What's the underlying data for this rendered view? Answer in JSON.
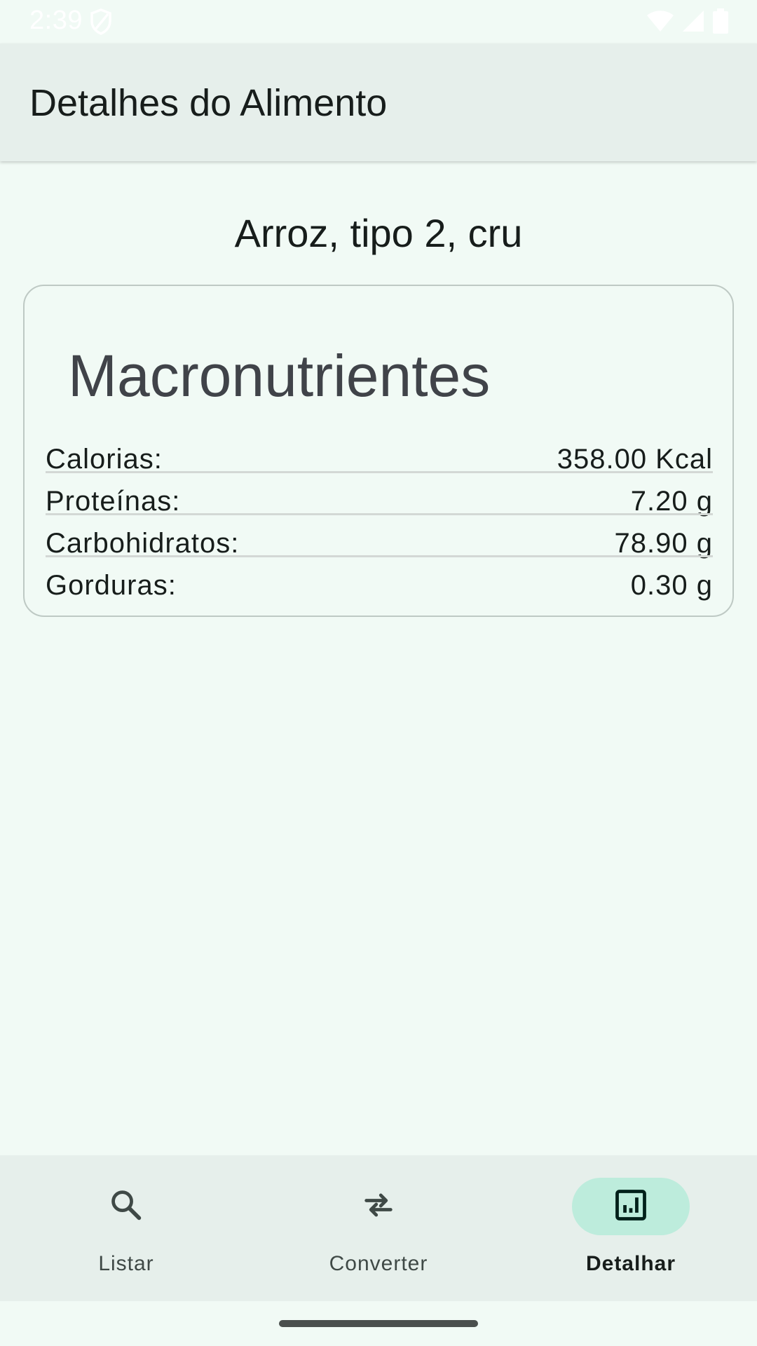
{
  "status_bar": {
    "time": "2:39",
    "icons": [
      "shield-icon",
      "wifi-icon",
      "signal-icon",
      "battery-icon"
    ]
  },
  "app_bar": {
    "title": "Detalhes do Alimento"
  },
  "food": {
    "name": "Arroz, tipo 2, cru"
  },
  "macros_card": {
    "title": "Macronutrientes",
    "rows": [
      {
        "label": "Calorias:",
        "value": "358.00 Kcal"
      },
      {
        "label": "Proteínas:",
        "value": "7.20 g"
      },
      {
        "label": "Carbohidratos:",
        "value": "78.90 g"
      },
      {
        "label": "Gorduras:",
        "value": "0.30 g"
      }
    ]
  },
  "bottom_nav": {
    "items": [
      {
        "label": "Listar",
        "icon": "search-icon",
        "active": false
      },
      {
        "label": "Converter",
        "icon": "swap-arrows-icon",
        "active": false
      },
      {
        "label": "Detalhar",
        "icon": "chart-icon",
        "active": true
      }
    ]
  },
  "colors": {
    "background": "#f1faf5",
    "app_bar": "#e6efeb",
    "active_pill": "#bdecdc",
    "card_border": "#bec9c4",
    "icon": "#3f4946",
    "active_icon": "#00201a"
  }
}
